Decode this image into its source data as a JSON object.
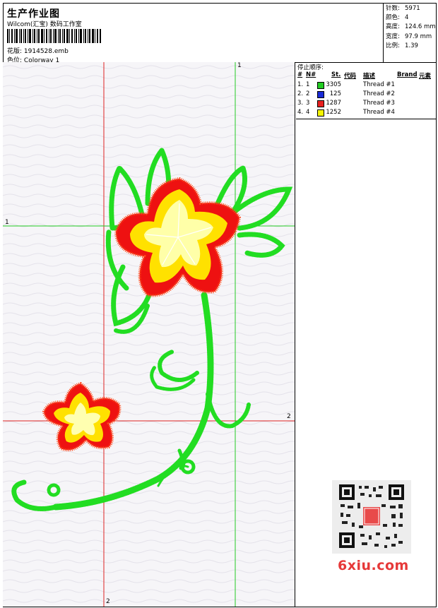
{
  "header": {
    "title": "生产作业图",
    "subtitle": "Wilcom(汇宝) 数码工作室",
    "design_label": "花版:",
    "design_value": "1914528.emb",
    "colorway_label": "色位:",
    "colorway_value": "Colorway 1"
  },
  "stats": {
    "stitches_label": "针数:",
    "stitches_value": "5971",
    "colors_label": "颜色:",
    "colors_value": "4",
    "height_label": "高度:",
    "height_value": "124.6 mm",
    "width_label": "宽度:",
    "width_value": "97.9 mm",
    "scale_label": "比例:",
    "scale_value": "1.39"
  },
  "thread_panel": {
    "title": "停止顺序:",
    "col_hash": "#",
    "col_n": "N#",
    "col_st": "St.",
    "col_code": "代码",
    "col_desc": "描述",
    "col_brand": "Brand",
    "col_element": "元素",
    "rows": [
      {
        "idx": "1.",
        "n": "1",
        "color": "#22cc22",
        "code": "3305",
        "desc": "Thread #1"
      },
      {
        "idx": "2.",
        "n": "2",
        "color": "#1a2bd6",
        "code": "125",
        "desc": "Thread #2"
      },
      {
        "idx": "3.",
        "n": "3",
        "color": "#e82020",
        "code": "1287",
        "desc": "Thread #3"
      },
      {
        "idx": "4.",
        "n": "4",
        "color": "#f4f400",
        "code": "1252",
        "desc": "Thread #4"
      }
    ]
  },
  "canvas": {
    "guide_green_top": "1",
    "guide_green_left": "1",
    "guide_red_right": "2",
    "guide_red_bottom": "2"
  },
  "branding": {
    "site": "6xiu.com"
  },
  "colors": {
    "green_thread": "#22dd22",
    "red_thread": "#ee1111",
    "yellow_thread": "#ffff00",
    "guide_green": "#22cc22",
    "guide_red": "#dd2222",
    "brand_red": "#e63838"
  }
}
